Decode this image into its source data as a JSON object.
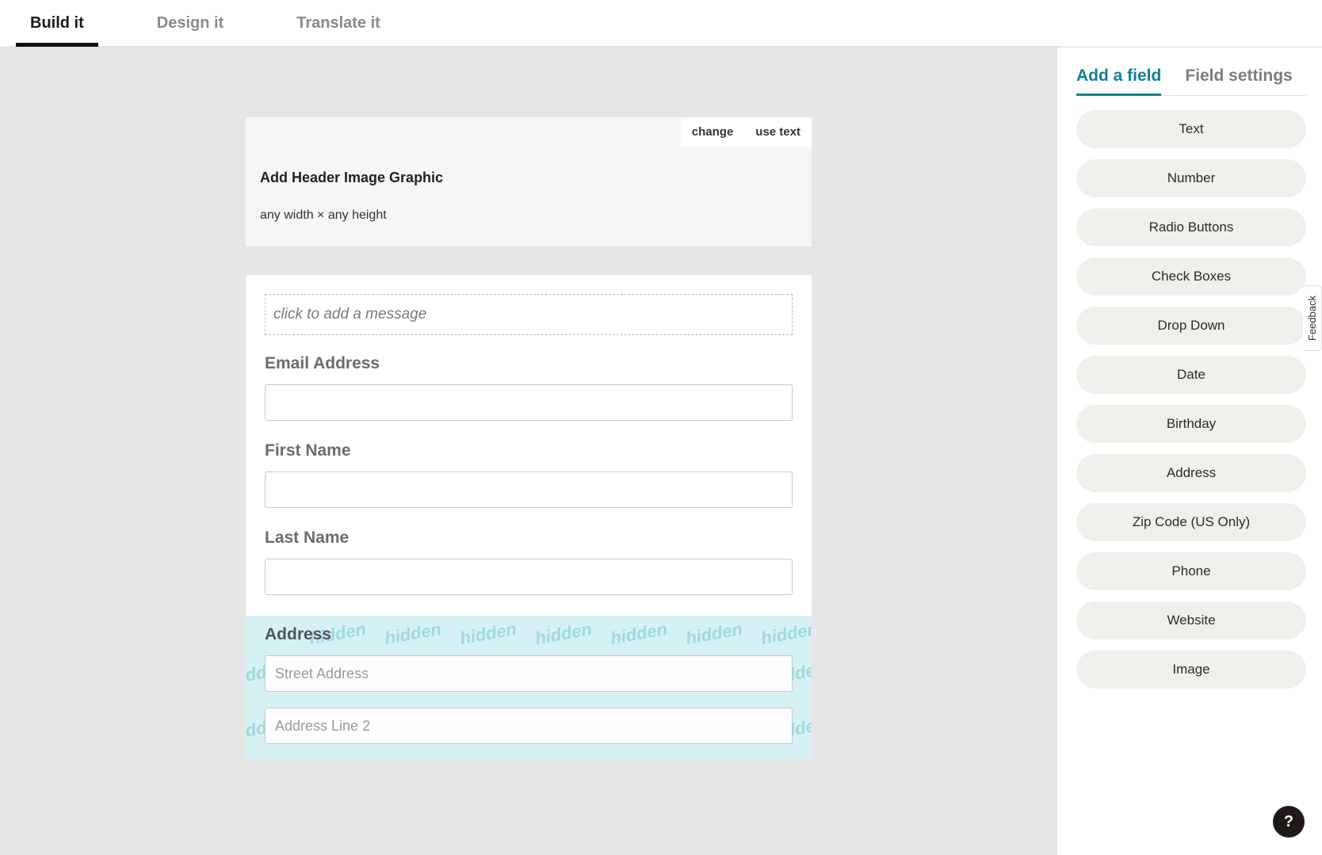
{
  "topTabs": {
    "build": "Build it",
    "design": "Design it",
    "translate": "Translate it"
  },
  "header": {
    "change": "change",
    "useText": "use text",
    "title": "Add Header Image Graphic",
    "dims": "any width × any height"
  },
  "form": {
    "message_placeholder": "click to add a message",
    "fields": {
      "email_label": "Email Address",
      "first_name_label": "First Name",
      "last_name_label": "Last Name",
      "address_label": "Address",
      "street_placeholder": "Street Address",
      "line2_placeholder": "Address Line 2"
    },
    "hidden_word": "hidden"
  },
  "sidebar": {
    "tab_add": "Add a field",
    "tab_settings": "Field settings",
    "fields": {
      "text": "Text",
      "number": "Number",
      "radio": "Radio Buttons",
      "check": "Check Boxes",
      "dropdown": "Drop Down",
      "date": "Date",
      "birthday": "Birthday",
      "address": "Address",
      "zip": "Zip Code (US Only)",
      "phone": "Phone",
      "website": "Website",
      "image": "Image"
    }
  },
  "feedback": "Feedback",
  "help": "?"
}
